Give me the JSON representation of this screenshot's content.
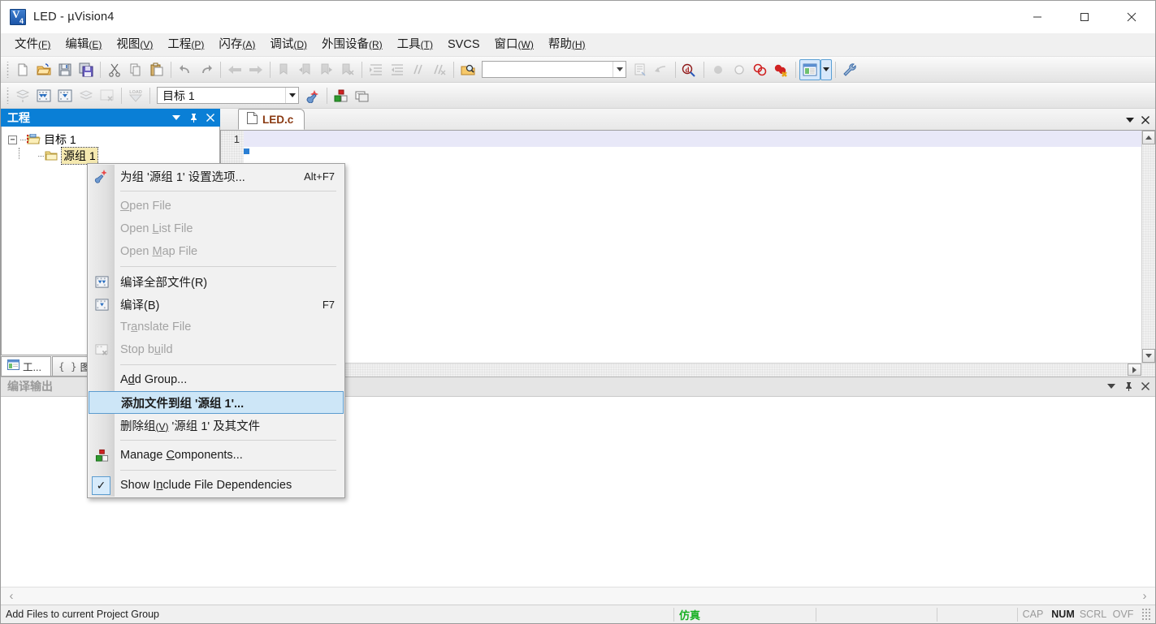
{
  "window": {
    "title": "LED  - µVision4",
    "icon": "uvision-logo-icon",
    "minimize": "–",
    "maximize": "□",
    "close": "✕"
  },
  "menubar": {
    "items": [
      {
        "name": "file",
        "text": "文件",
        "accel": "(F)"
      },
      {
        "name": "edit",
        "text": "编辑",
        "accel": "(E)"
      },
      {
        "name": "view",
        "text": "视图",
        "accel": "(V)"
      },
      {
        "name": "project",
        "text": "工程",
        "accel": "(P)"
      },
      {
        "name": "flash",
        "text": "闪存",
        "accel": "(A)"
      },
      {
        "name": "debug",
        "text": "调试",
        "accel": "(D)"
      },
      {
        "name": "peripheral",
        "text": "外围设备",
        "accel": "(R)"
      },
      {
        "name": "tools",
        "text": "工具",
        "accel": "(T)"
      },
      {
        "name": "svcs",
        "text": "SVCS",
        "accel": ""
      },
      {
        "name": "window",
        "text": "窗口",
        "accel": "(W)"
      },
      {
        "name": "help",
        "text": "帮助",
        "accel": "(H)"
      }
    ]
  },
  "toolbar_main": {
    "find_combo_value": "",
    "buttons": [
      "new-file-icon",
      "open-file-icon",
      "save-icon",
      "save-all-icon",
      "cut-icon",
      "copy-icon",
      "paste-icon",
      "undo-icon",
      "redo-icon",
      "navigate-back-icon",
      "navigate-forward-icon",
      "bookmark-toggle-icon",
      "bookmark-prev-icon",
      "bookmark-next-icon",
      "bookmark-clear-icon",
      "indent-icon",
      "outdent-icon",
      "comment-icon",
      "uncomment-icon",
      "find-in-files-icon",
      "find-combo",
      "configuration-wizard-icon",
      "debug-step-icon",
      "start-debug-icon",
      "insert-breakpoint-icon",
      "disable-breakpoint-icon",
      "kill-all-breakpoints-icon",
      "disable-all-breakpoints-icon",
      "project-window-icon",
      "project-window-dropdown-icon",
      "settings-wrench-icon"
    ]
  },
  "toolbar_build": {
    "target_label": "目标 1",
    "buttons": [
      "translate-icon",
      "build-icon",
      "rebuild-icon",
      "batch-build-icon",
      "stop-build-icon",
      "download-icon",
      "target-combo",
      "target-options-icon",
      "manage-components-icon",
      "manage-multiproject-icon"
    ]
  },
  "project_panel": {
    "title": "工程",
    "menu_icon": "▼",
    "pin_icon": "ᐁ",
    "close_icon": "✕",
    "tree": {
      "root": {
        "label": "目标 1",
        "expander": "−",
        "icon": "target-folder-icon"
      },
      "child": {
        "label": "源组 1",
        "icon": "group-folder-icon",
        "selected": true
      }
    },
    "tabs": [
      {
        "name": "project",
        "label": "工...",
        "icon": "project-tab-icon",
        "active": true
      },
      {
        "name": "books",
        "label": "图",
        "icon": "books-tab-icon",
        "active": false
      }
    ]
  },
  "editor": {
    "tab": {
      "label": "LED.c",
      "icon": "c-file-icon"
    },
    "tabstrip_buttons": [
      "▼",
      "✕"
    ],
    "line_numbers": [
      "1"
    ],
    "lines": [
      ""
    ]
  },
  "build_output": {
    "title": "编译输出",
    "menu_icon": "▼",
    "pin_icon": "ᐁ",
    "close_icon": "✕",
    "content": "",
    "scroll_left_icon": "‹",
    "scroll_right_icon": "›"
  },
  "context_menu": {
    "items": [
      {
        "name": "options-for-group",
        "label": "为组 '源组 1' 设置选项...",
        "accel": "Alt+F7",
        "icon": "options-wand-icon",
        "state": "normal"
      },
      {
        "name": "separator-1",
        "type": "separator"
      },
      {
        "name": "open-file",
        "label": "Open File",
        "accel": "",
        "underline": "O",
        "icon": "",
        "state": "disabled"
      },
      {
        "name": "open-list-file",
        "label": "Open List File",
        "accel": "",
        "underline": "L",
        "icon": "",
        "state": "disabled"
      },
      {
        "name": "open-map-file",
        "label": "Open Map File",
        "accel": "",
        "underline": "M",
        "icon": "",
        "state": "disabled"
      },
      {
        "name": "separator-2",
        "type": "separator"
      },
      {
        "name": "rebuild-all-files",
        "label": "编译全部文件(R)",
        "accel": "",
        "icon": "rebuild-icon",
        "state": "normal"
      },
      {
        "name": "build",
        "label": "编译(B)",
        "accel": "F7",
        "icon": "build-icon",
        "state": "normal"
      },
      {
        "name": "translate-file",
        "label": "Translate File",
        "accel": "",
        "underline": "a",
        "icon": "",
        "state": "disabled"
      },
      {
        "name": "stop-build",
        "label": "Stop build",
        "accel": "",
        "underline": "u",
        "icon": "stop-build-icon",
        "state": "disabled"
      },
      {
        "name": "separator-3",
        "type": "separator"
      },
      {
        "name": "add-group",
        "label": "Add Group...",
        "accel": "",
        "underline": "d",
        "icon": "",
        "state": "normal"
      },
      {
        "name": "add-files-to-group",
        "label": "添加文件到组 '源组 1'...",
        "accel": "",
        "icon": "",
        "state": "highlighted"
      },
      {
        "name": "remove-group",
        "label": "删除组(V) '源组 1' 及其文件",
        "accel": "",
        "icon": "",
        "state": "normal"
      },
      {
        "name": "separator-4",
        "type": "separator"
      },
      {
        "name": "manage-components",
        "label": "Manage Components...",
        "accel": "",
        "underline": "C",
        "icon": "manage-components-icon",
        "state": "normal"
      },
      {
        "name": "separator-5",
        "type": "separator"
      },
      {
        "name": "show-include-file-dependencies",
        "label": "Show Include File Dependencies",
        "accel": "",
        "underline": "n",
        "icon": "checkmark-icon",
        "state": "checked"
      }
    ]
  },
  "statusbar": {
    "message": "Add Files to current Project Group",
    "simulation": "仿真",
    "cell_2": "",
    "cell_3": "",
    "indicators": [
      {
        "name": "cap",
        "label": "CAP",
        "active": false
      },
      {
        "name": "num",
        "label": "NUM",
        "active": true
      },
      {
        "name": "scrl",
        "label": "SCRL",
        "active": false
      },
      {
        "name": "ovf",
        "label": "OVF",
        "active": false
      }
    ]
  },
  "colors": {
    "panel_title_bg": "#0a7fd6",
    "highlight_bg": "#cde6f7",
    "highlight_border": "#5c9ccf",
    "sim_green": "#18b024",
    "tab_text": "#8a3a12",
    "selection_yellow": "#f5e9b0"
  }
}
